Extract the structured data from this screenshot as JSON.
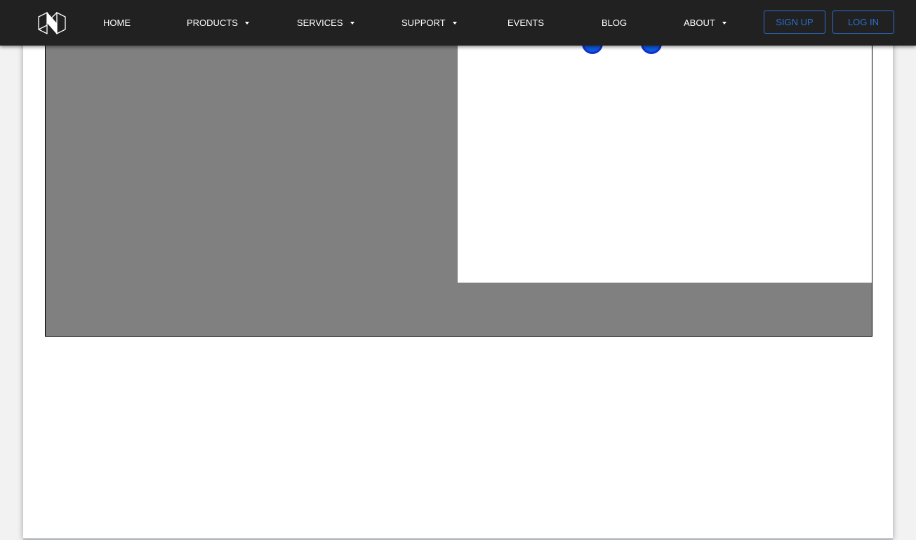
{
  "nav": {
    "home": "HOME",
    "products": "PRODUCTS",
    "services": "SERVICES",
    "support": "SUPPORT",
    "events": "EVENTS",
    "blog": "BLOG",
    "about": "ABOUT"
  },
  "auth": {
    "signup": "SIGN UP",
    "login": "LOG IN"
  },
  "colors": {
    "navbar_bg": "#212121",
    "accent": "#2c6fd1",
    "placeholder_gray": "#808080",
    "dot_fill": "#0d5be0"
  }
}
